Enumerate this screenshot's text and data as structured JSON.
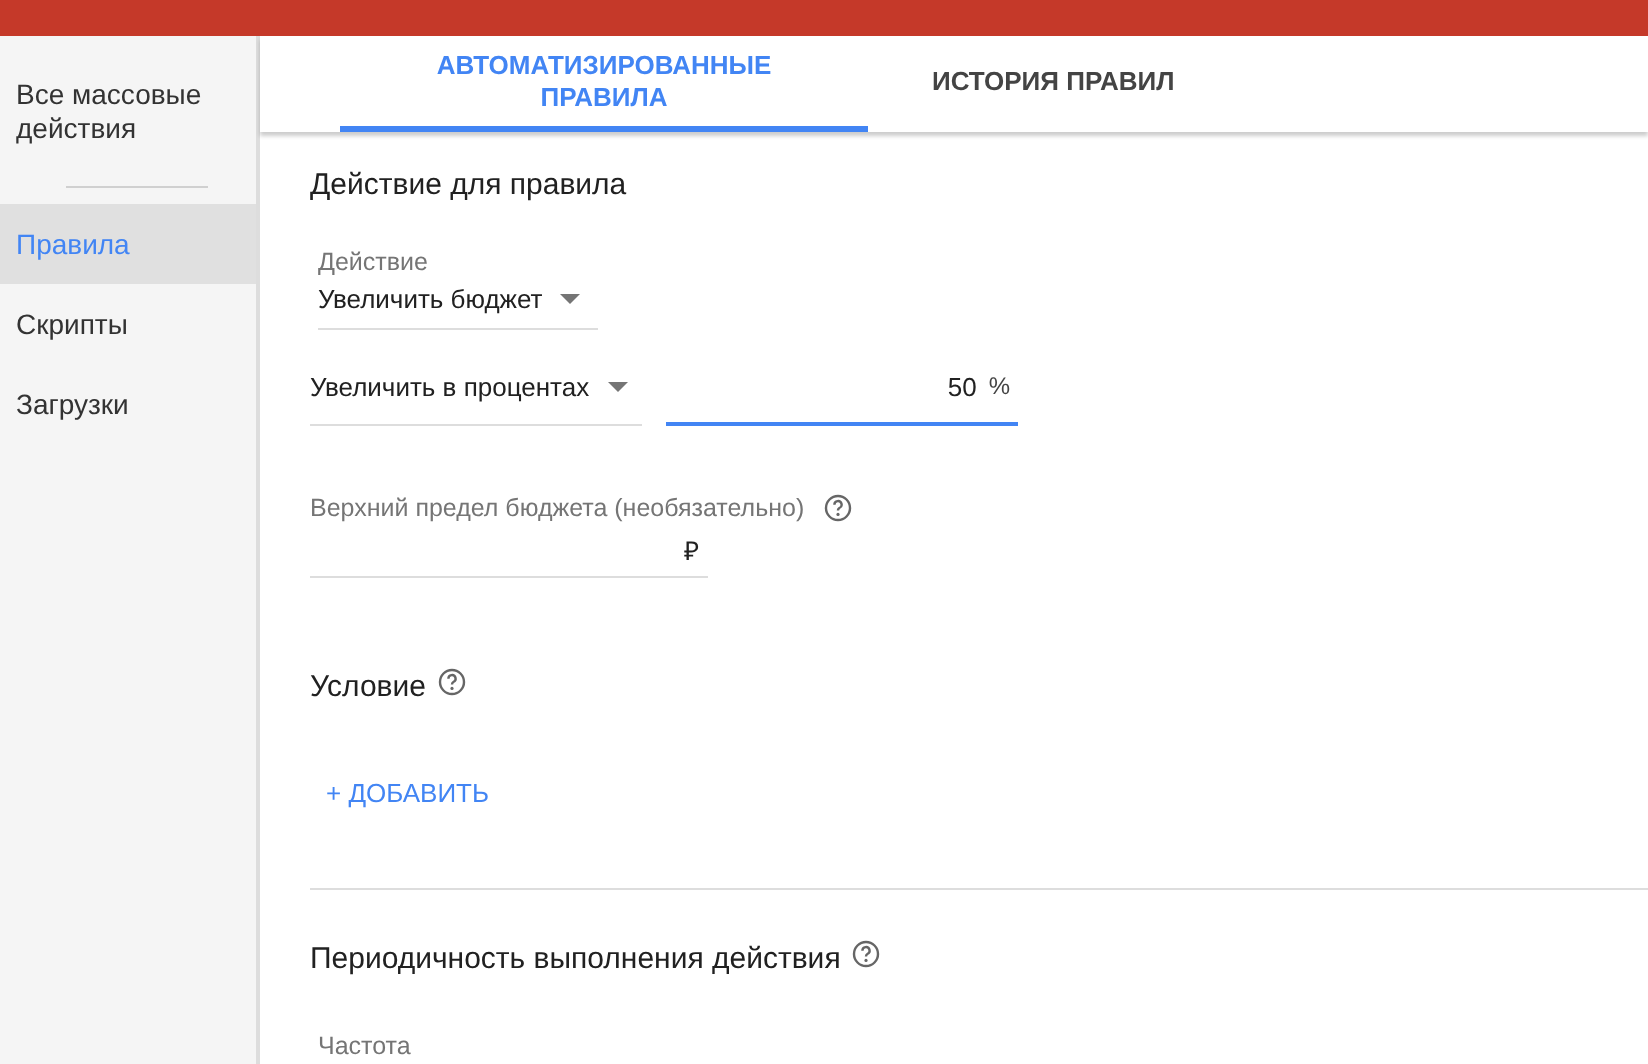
{
  "sidebar": {
    "items": [
      {
        "label": "Все массовые действия",
        "selected": false
      },
      {
        "label": "Правила",
        "selected": true
      },
      {
        "label": "Скрипты",
        "selected": false
      },
      {
        "label": "Загрузки",
        "selected": false
      }
    ]
  },
  "tabs": [
    {
      "label": "АВТОМАТИЗИРОВАННЫЕ ПРАВИЛА",
      "selected": true
    },
    {
      "label": "ИСТОРИЯ ПРАВИЛ",
      "selected": false
    }
  ],
  "action_section": {
    "title": "Действие для правила",
    "action": {
      "label": "Действие",
      "value": "Увеличить бюджет"
    },
    "mode": {
      "value": "Увеличить в процентах"
    },
    "amount": {
      "value": "50",
      "suffix": "%",
      "focused": true
    },
    "limit": {
      "label": "Верхний предел бюджета (необязательно)",
      "suffix": "₽"
    }
  },
  "condition_section": {
    "title": "Условие",
    "add_button": "+ ДОБАВИТЬ"
  },
  "frequency_section": {
    "title": "Периодичность выполнения действия",
    "frequency_label": "Частота"
  }
}
